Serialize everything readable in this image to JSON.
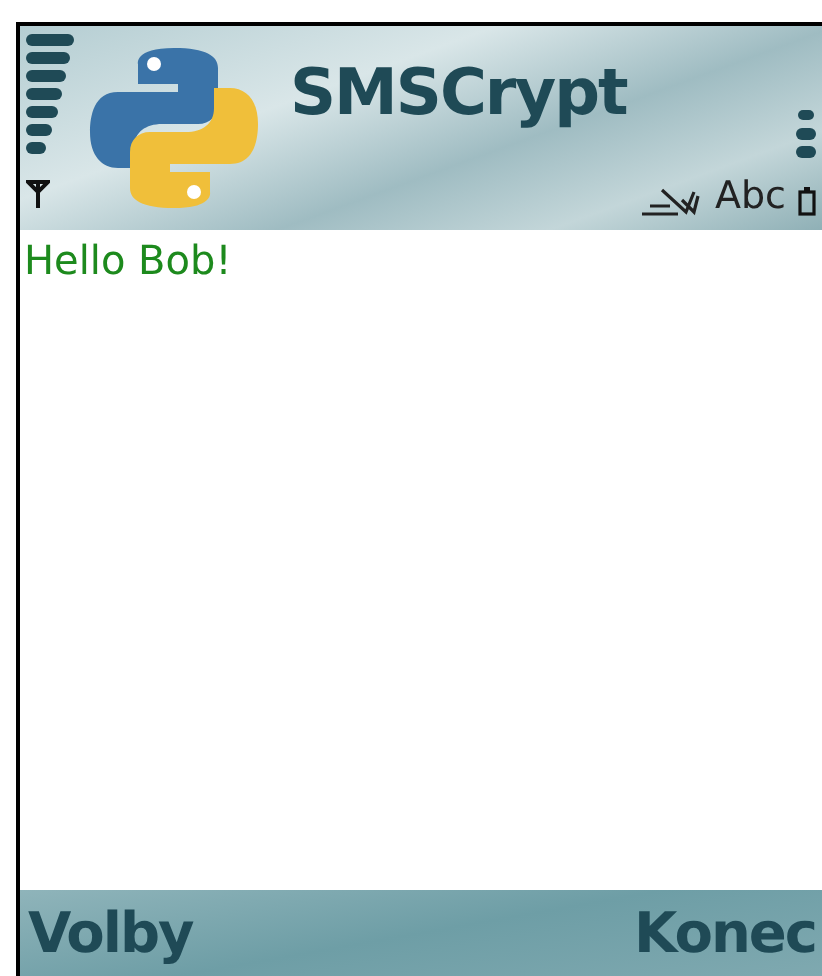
{
  "title": "SMSCrypt",
  "input_mode": "Abc",
  "message": "Hello Bob!",
  "softkeys": {
    "left": "Volby",
    "right": "Konec"
  }
}
